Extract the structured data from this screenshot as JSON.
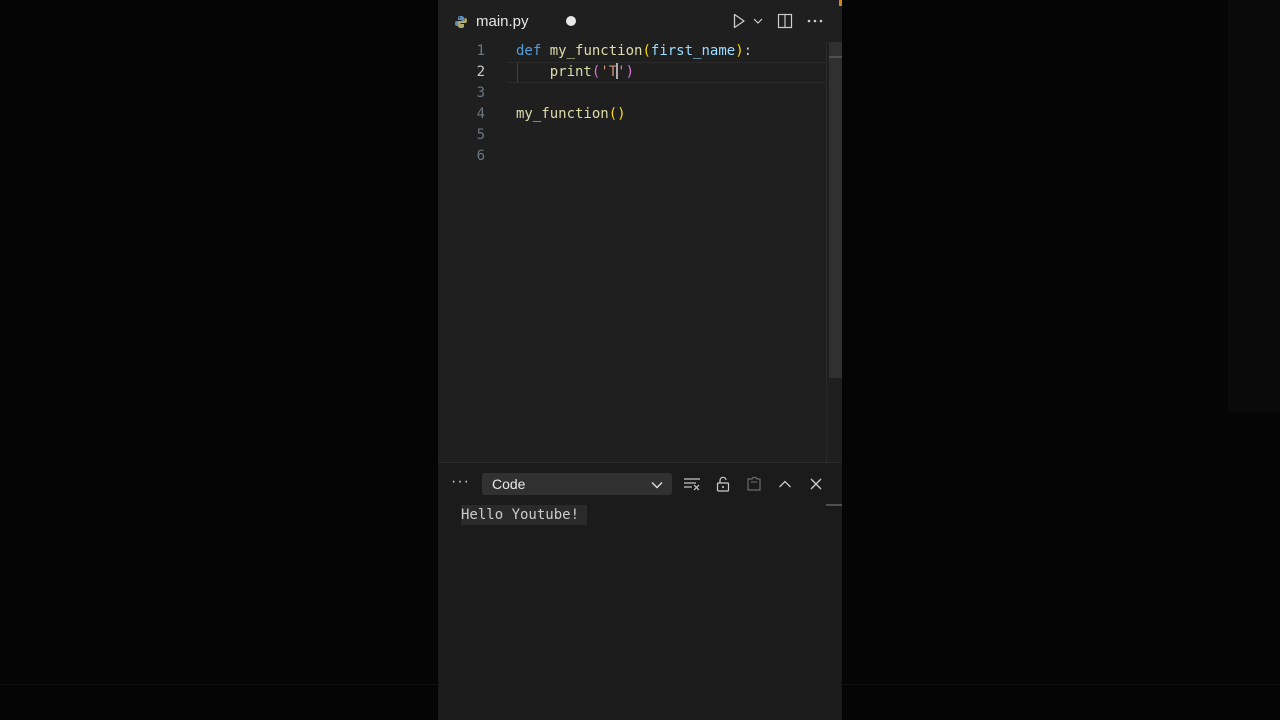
{
  "tab": {
    "filename": "main.py",
    "language_icon": "python-icon",
    "unsaved": true
  },
  "toolbar": {
    "run_icon": "play-icon",
    "run_dropdown_icon": "chevron-down-icon",
    "split_icon": "split-editor-icon",
    "more_icon": "ellipsis-icon"
  },
  "editor": {
    "active_line": 2,
    "lines": [
      {
        "number": "1",
        "tokens": [
          {
            "text": "def",
            "cls": "kw"
          },
          {
            "text": " ",
            "cls": ""
          },
          {
            "text": "my_function",
            "cls": "fn"
          },
          {
            "text": "(",
            "cls": "p1"
          },
          {
            "text": "first_name",
            "cls": "param"
          },
          {
            "text": ")",
            "cls": "p1"
          },
          {
            "text": ":",
            "cls": ""
          }
        ]
      },
      {
        "number": "2",
        "tokens": [
          {
            "text": "    ",
            "cls": ""
          },
          {
            "text": "print",
            "cls": "fn"
          },
          {
            "text": "(",
            "cls": "p2"
          },
          {
            "text": "'T",
            "cls": "str"
          },
          {
            "text": "|CURSOR|",
            "cls": "cursor"
          },
          {
            "text": "'",
            "cls": "str"
          },
          {
            "text": ")",
            "cls": "p2"
          }
        ]
      },
      {
        "number": "3",
        "tokens": []
      },
      {
        "number": "4",
        "tokens": [
          {
            "text": "my_function",
            "cls": "fn"
          },
          {
            "text": "()",
            "cls": "p1"
          }
        ]
      },
      {
        "number": "5",
        "tokens": []
      },
      {
        "number": "6",
        "tokens": []
      }
    ]
  },
  "panel": {
    "more_label": "···",
    "output_channel": "Code",
    "icons": [
      "clear-output-icon",
      "lock-icon",
      "open-file-icon",
      "maximize-panel-icon",
      "close-icon"
    ],
    "output_lines": [
      "Hello Youtube!"
    ]
  },
  "colors": {
    "editor_bg": "#1f1f1f",
    "panel_bg": "#1b1b1b",
    "keyword": "#569cd6",
    "function": "#dcdcaa",
    "parameter": "#9cdcfe",
    "string": "#ce9178"
  }
}
